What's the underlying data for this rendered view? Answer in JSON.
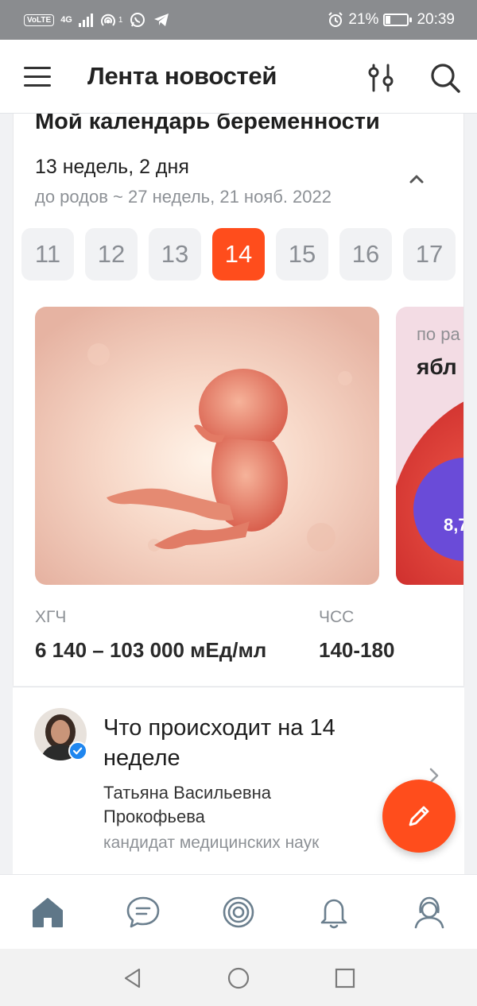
{
  "status_bar": {
    "network_badge": "VoLTE",
    "network_type": "4G",
    "sim_slot": "1",
    "battery_percent": "21%",
    "time": "20:39",
    "icons": [
      "wifi-hotspot-icon",
      "whatsapp-icon",
      "telegram-icon",
      "alarm-icon",
      "battery-icon"
    ]
  },
  "header": {
    "title": "Лента новостей",
    "icons": {
      "menu": "hamburger-menu-icon",
      "filter": "filter-sliders-icon",
      "search": "search-icon"
    }
  },
  "calendar": {
    "title": "Мой календарь беременности",
    "current_week": "13 недель, 2 дня",
    "due": "до родов ~ 27 недель, 21 нояб. 2022",
    "weeks": [
      "11",
      "12",
      "13",
      "14",
      "15",
      "16",
      "17"
    ],
    "selected_week": "14",
    "fruit": {
      "label": "по ра",
      "name": "ябл",
      "badge_value": "8,7"
    },
    "metrics": [
      {
        "label": "ХГЧ",
        "value": "6 140 – 103 000 мЕд/мл"
      },
      {
        "label": "ЧСС",
        "value": "140-180"
      }
    ]
  },
  "article": {
    "title": "Что происходит на 14 неделе",
    "author": "Татьяна Васильевна Прокофьева",
    "role": "кандидат медицинских наук"
  },
  "bottom_nav": [
    "home-icon",
    "chat-icon",
    "target-icon",
    "bell-icon",
    "profile-icon"
  ],
  "colors": {
    "accent": "#ff4d1c",
    "badge": "#6a4bd8",
    "verified": "#1f86ef"
  }
}
